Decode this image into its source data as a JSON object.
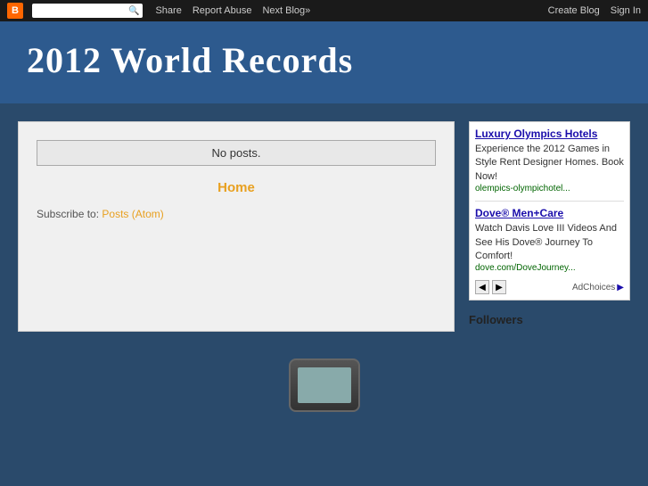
{
  "navbar": {
    "links": [
      "Share",
      "Report Abuse",
      "Next Blog»"
    ],
    "right_links": [
      "Create Blog",
      "Sign In"
    ],
    "search_placeholder": ""
  },
  "header": {
    "title": "2012 World Records"
  },
  "main": {
    "no_posts": "No posts.",
    "home_label": "Home",
    "subscribe_prefix": "Subscribe to:",
    "subscribe_link": "Posts (Atom)"
  },
  "sidebar": {
    "ad1": {
      "title": "Luxury Olympics Hotels",
      "body": "Experience the 2012 Games in Style Rent Designer Homes. Book Now!",
      "url": "olempics-olympichotel..."
    },
    "ad2": {
      "title": "Dove® Men+Care",
      "body": "Watch Davis Love III Videos And See His Dove® Journey To Comfort!",
      "url": "dove.com/DoveJourney..."
    },
    "nav_prev": "◀",
    "nav_next": "▶",
    "adchoices_label": "AdChoices",
    "followers_title": "Followers"
  }
}
